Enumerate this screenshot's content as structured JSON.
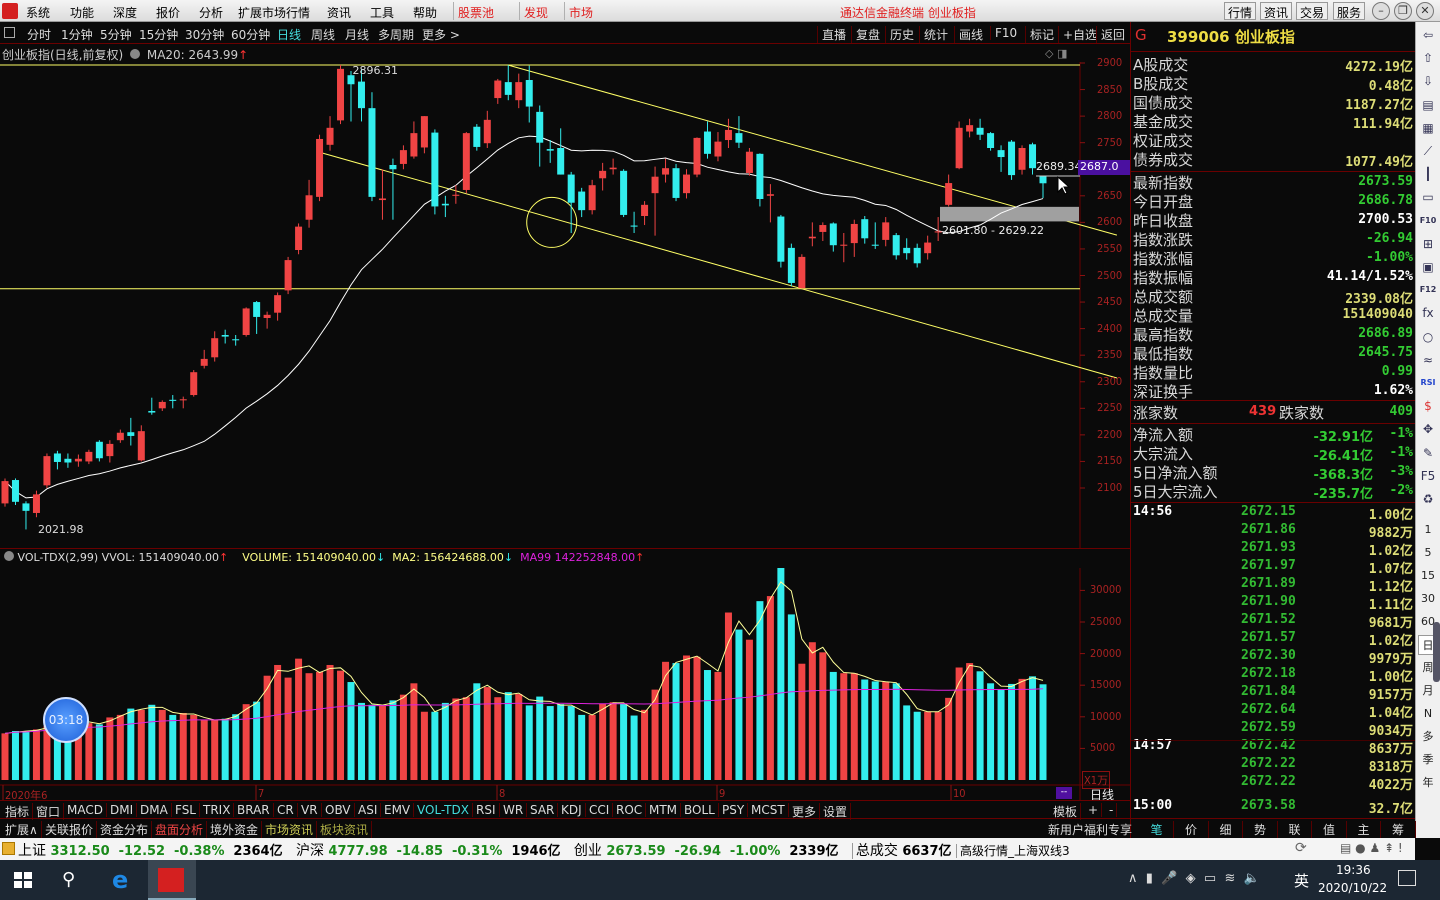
{
  "menubar": {
    "items": [
      "系统",
      "功能",
      "深度",
      "报价",
      "分析",
      "扩展市场行情",
      "资讯",
      "工具",
      "帮助"
    ],
    "special": [
      "股票池",
      "发现",
      "市场"
    ],
    "title": "通达信金融终端 创业板指",
    "right_buttons": [
      "行情",
      "资讯",
      "交易",
      "服务"
    ]
  },
  "toolbar": {
    "periods": [
      "分时",
      "1分钟",
      "5分钟",
      "15分钟",
      "30分钟",
      "60分钟",
      "日线",
      "周线",
      "月线",
      "多周期",
      "更多 >"
    ],
    "active_period": "日线",
    "actions": [
      "直播",
      "复盘",
      "历史",
      "统计",
      "画线",
      "F10",
      "标记",
      "+自选",
      "返回"
    ]
  },
  "chart_info": {
    "name": "创业板指(日线,前复权)",
    "ma20": "MA20: 2643.99"
  },
  "colors": {
    "up": "#f04444",
    "down": "#33eeee",
    "ma20": "#ffffff",
    "vol_ma2": "#ffff99",
    "vol_ma99": "#dd22dd",
    "drawing": "#ffff66",
    "axis": "#a82222"
  },
  "chart_data": [
    {
      "type": "candlestick",
      "title": "创业板指(日线,前复权)",
      "ylim": [
        2100,
        2900
      ],
      "yticks": [
        2900,
        2850,
        2800,
        2750,
        2700,
        2650,
        2600,
        2550,
        2500,
        2450,
        2400,
        2350,
        2300,
        2250,
        2200,
        2150,
        2100
      ],
      "xticks": [
        "2020年6",
        "7",
        "8",
        "9",
        "10"
      ],
      "ohlc": [
        [
          2071,
          2118,
          2065,
          2113
        ],
        [
          2115,
          2118,
          2068,
          2074
        ],
        [
          2071,
          2075,
          2022,
          2057
        ],
        [
          2053,
          2095,
          2045,
          2088
        ],
        [
          2105,
          2165,
          2100,
          2160
        ],
        [
          2165,
          2170,
          2135,
          2149
        ],
        [
          2155,
          2165,
          2138,
          2148
        ],
        [
          2150,
          2163,
          2140,
          2155
        ],
        [
          2150,
          2172,
          2145,
          2168
        ],
        [
          2187,
          2190,
          2150,
          2156
        ],
        [
          2160,
          2190,
          2148,
          2183
        ],
        [
          2190,
          2210,
          2185,
          2204
        ],
        [
          2205,
          2232,
          2180,
          2198
        ],
        [
          2152,
          2218,
          2150,
          2207
        ],
        [
          2245,
          2270,
          2238,
          2242
        ],
        [
          2250,
          2265,
          2245,
          2262
        ],
        [
          2266,
          2275,
          2250,
          2264
        ],
        [
          2265,
          2272,
          2250,
          2267
        ],
        [
          2275,
          2322,
          2272,
          2318
        ],
        [
          2330,
          2360,
          2325,
          2343
        ],
        [
          2346,
          2395,
          2338,
          2382
        ],
        [
          2388,
          2398,
          2372,
          2385
        ],
        [
          2380,
          2388,
          2368,
          2378
        ],
        [
          2388,
          2440,
          2385,
          2438
        ],
        [
          2450,
          2452,
          2390,
          2422
        ],
        [
          2420,
          2432,
          2400,
          2426
        ],
        [
          2430,
          2468,
          2415,
          2463
        ],
        [
          2472,
          2535,
          2465,
          2529
        ],
        [
          2548,
          2598,
          2540,
          2592
        ],
        [
          2605,
          2680,
          2590,
          2651
        ],
        [
          2648,
          2765,
          2640,
          2757
        ],
        [
          2746,
          2800,
          2735,
          2778
        ],
        [
          2792,
          2896.31,
          2785,
          2889
        ],
        [
          2877,
          2885,
          2790,
          2860
        ],
        [
          2865,
          2888,
          2790,
          2815
        ],
        [
          2815,
          2845,
          2640,
          2648
        ],
        [
          2642,
          2700,
          2605,
          2645
        ],
        [
          2708,
          2720,
          2605,
          2700
        ],
        [
          2710,
          2745,
          2700,
          2736
        ],
        [
          2724,
          2790,
          2720,
          2768
        ],
        [
          2741,
          2800,
          2730,
          2800
        ],
        [
          2769,
          2775,
          2615,
          2630
        ],
        [
          2635,
          2650,
          2610,
          2632
        ],
        [
          2650,
          2670,
          2635,
          2652
        ],
        [
          2661,
          2770,
          2655,
          2768
        ],
        [
          2780,
          2785,
          2735,
          2742
        ],
        [
          2749,
          2810,
          2740,
          2793
        ],
        [
          2834,
          2870,
          2823,
          2867
        ],
        [
          2864,
          2896,
          2830,
          2840
        ],
        [
          2830,
          2880,
          2815,
          2864
        ],
        [
          2868,
          2895,
          2788,
          2818
        ],
        [
          2808,
          2820,
          2705,
          2750
        ],
        [
          2738,
          2755,
          2712,
          2735
        ],
        [
          2740,
          2777,
          2690,
          2690
        ],
        [
          2690,
          2695,
          2580,
          2637
        ],
        [
          2658,
          2665,
          2610,
          2623
        ],
        [
          2623,
          2680,
          2615,
          2670
        ],
        [
          2683,
          2712,
          2660,
          2697
        ],
        [
          2700,
          2720,
          2690,
          2703
        ],
        [
          2697,
          2700,
          2610,
          2614
        ],
        [
          2594,
          2620,
          2580,
          2592
        ],
        [
          2612,
          2640,
          2595,
          2633
        ],
        [
          2655,
          2705,
          2575,
          2686
        ],
        [
          2690,
          2720,
          2675,
          2702
        ],
        [
          2702,
          2710,
          2640,
          2646
        ],
        [
          2655,
          2700,
          2645,
          2690
        ],
        [
          2690,
          2760,
          2685,
          2759
        ],
        [
          2771,
          2790,
          2720,
          2729
        ],
        [
          2724,
          2770,
          2715,
          2752
        ],
        [
          2755,
          2795,
          2740,
          2774
        ],
        [
          2768,
          2800,
          2740,
          2750
        ],
        [
          2693,
          2740,
          2688,
          2733
        ],
        [
          2729,
          2730,
          2630,
          2644
        ],
        [
          2650,
          2672,
          2600,
          2653
        ],
        [
          2611,
          2614,
          2515,
          2526
        ],
        [
          2552,
          2560,
          2480,
          2486
        ],
        [
          2476,
          2540,
          2476,
          2535
        ],
        [
          2570,
          2600,
          2555,
          2573
        ],
        [
          2582,
          2600,
          2565,
          2595
        ],
        [
          2598,
          2600,
          2545,
          2557
        ],
        [
          2556,
          2580,
          2525,
          2558
        ],
        [
          2561,
          2605,
          2535,
          2597
        ],
        [
          2606,
          2612,
          2560,
          2570
        ],
        [
          2558,
          2600,
          2550,
          2556
        ],
        [
          2567,
          2610,
          2555,
          2600
        ],
        [
          2576,
          2580,
          2530,
          2538
        ],
        [
          2552,
          2570,
          2530,
          2542
        ],
        [
          2552,
          2560,
          2515,
          2523
        ],
        [
          2542,
          2575,
          2530,
          2562
        ],
        [
          2581,
          2610,
          2565,
          2583
        ],
        [
          2633,
          2690,
          2630,
          2674
        ],
        [
          2702,
          2790,
          2700,
          2778
        ],
        [
          2771,
          2795,
          2760,
          2783
        ],
        [
          2778,
          2795,
          2755,
          2765
        ],
        [
          2768,
          2770,
          2735,
          2740
        ],
        [
          2736,
          2745,
          2695,
          2723
        ],
        [
          2752,
          2755,
          2680,
          2689
        ],
        [
          2699,
          2745,
          2690,
          2740
        ],
        [
          2747,
          2750,
          2690,
          2702
        ],
        [
          2686.78,
          2686.89,
          2645.75,
          2673.59
        ]
      ],
      "ma_period": 20,
      "annotations": {
        "high_label": "2896.31",
        "low_label": "2021.98",
        "range_label": "2601.80 - 2629.22",
        "range": [
          2601.8,
          2629.22
        ],
        "cursor_label": "2689.34",
        "axis_tag": "2687.0",
        "hlines": [
          2896.31,
          2475
        ],
        "channel_upper": {
          "from": [
            48,
            2896
          ],
          "to": [
            103,
            2576
          ]
        },
        "channel_lower": {
          "from": [
            30,
            2732
          ],
          "to": [
            103,
            2307
          ]
        },
        "circle_at": [
          51,
          2600
        ]
      }
    },
    {
      "type": "bar",
      "title": "VOL-TDX(2,99)",
      "unit_label": "X1万",
      "ylim": [
        0,
        34000
      ],
      "yticks": [
        30000,
        25000,
        20000,
        15000,
        10000,
        5000
      ],
      "legend": {
        "vvol": "VOL-TDX(2,99) VVOL: 151409040.00",
        "volume": "VOLUME: 151409040.00",
        "ma2": "MA2: 156424688.00",
        "ma99": "MA99 142252848.00"
      },
      "values": [
        7380,
        7750,
        7700,
        8000,
        8500,
        8500,
        8800,
        9400,
        9000,
        8800,
        9900,
        10300,
        11300,
        11100,
        11900,
        11100,
        10300,
        10600,
        10300,
        9500,
        9500,
        9700,
        10400,
        12000,
        12400,
        16500,
        18200,
        16200,
        19200,
        16900,
        17100,
        18200,
        17300,
        15500,
        12200,
        11900,
        11800,
        12600,
        13500,
        15300,
        10800,
        10800,
        12200,
        12900,
        13100,
        15300,
        14700,
        13100,
        13900,
        13600,
        11800,
        13200,
        11700,
        12000,
        11700,
        10300,
        10300,
        12100,
        12300,
        12100,
        10200,
        11100,
        14300,
        18700,
        18500,
        19700,
        19500,
        17400,
        17100,
        26500,
        23800,
        22200,
        28300,
        29100,
        33600,
        26200,
        18400,
        21800,
        20200,
        17100,
        16900,
        16900,
        15900,
        15600,
        15500,
        15300,
        11800,
        10800,
        10800,
        10800,
        13000,
        17800,
        18500,
        17200,
        15300,
        14400,
        15200,
        16000,
        16400,
        15141
      ]
    }
  ],
  "timer": "03:18",
  "period_label": "日线",
  "right_panel": {
    "header_code": "G",
    "header_title": "399006 创业板指",
    "volumes": [
      {
        "label": "A股成交",
        "value": "4272.19亿"
      },
      {
        "label": "B股成交",
        "value": "0.48亿"
      },
      {
        "label": "国债成交",
        "value": "1187.27亿"
      },
      {
        "label": "基金成交",
        "value": "111.94亿"
      },
      {
        "label": "权证成交",
        "value": ""
      },
      {
        "label": "债券成交",
        "value": "1077.49亿"
      }
    ],
    "stats": [
      {
        "label": "最新指数",
        "value": "2673.59",
        "c": "g"
      },
      {
        "label": "今日开盘",
        "value": "2686.78",
        "c": "g"
      },
      {
        "label": "昨日收盘",
        "value": "2700.53",
        "c": "w"
      },
      {
        "label": "指数涨跌",
        "value": "-26.94",
        "c": "g"
      },
      {
        "label": "指数涨幅",
        "value": "-1.00%",
        "c": "g"
      },
      {
        "label": "指数振幅",
        "value": "41.14/1.52%",
        "c": "w"
      },
      {
        "label": "总成交额",
        "value": "2339.08亿",
        "c": "y"
      },
      {
        "label": "总成交量",
        "value": "151409040",
        "c": "y"
      },
      {
        "label": "最高指数",
        "value": "2686.89",
        "c": "g"
      },
      {
        "label": "最低指数",
        "value": "2645.75",
        "c": "g"
      },
      {
        "label": "指数量比",
        "value": "0.99",
        "c": "g"
      },
      {
        "label": "深证换手",
        "value": "1.62%",
        "c": "w"
      }
    ],
    "breadth": {
      "up_label": "涨家数",
      "up_value": "439",
      "down_label": "跌家数",
      "down_value": "409"
    },
    "flows": [
      {
        "label": "净流入额",
        "value": "-32.91亿",
        "pct": "-1%"
      },
      {
        "label": "大宗流入",
        "value": "-26.41亿",
        "pct": "-1%"
      },
      {
        "label": "5日净流入额",
        "value": "-368.3亿",
        "pct": "-3%"
      },
      {
        "label": "5日大宗流入",
        "value": "-235.7亿",
        "pct": "-2%"
      }
    ],
    "ticks": [
      {
        "time": "14:56",
        "price": "2672.15",
        "vol": "1.00亿"
      },
      {
        "time": "",
        "price": "2671.86",
        "vol": "9882万"
      },
      {
        "time": "",
        "price": "2671.93",
        "vol": "1.02亿"
      },
      {
        "time": "",
        "price": "2671.97",
        "vol": "1.07亿"
      },
      {
        "time": "",
        "price": "2671.89",
        "vol": "1.12亿"
      },
      {
        "time": "",
        "price": "2671.90",
        "vol": "1.11亿"
      },
      {
        "time": "",
        "price": "2671.52",
        "vol": "9681万"
      },
      {
        "time": "",
        "price": "2671.57",
        "vol": "1.02亿"
      },
      {
        "time": "",
        "price": "2672.30",
        "vol": "9979万"
      },
      {
        "time": "",
        "price": "2672.18",
        "vol": "1.00亿"
      },
      {
        "time": "",
        "price": "2671.84",
        "vol": "9157万"
      },
      {
        "time": "",
        "price": "2672.64",
        "vol": "1.04亿"
      },
      {
        "time": "",
        "price": "2672.59",
        "vol": "9034万"
      },
      {
        "time": "14:57",
        "price": "2672.42",
        "vol": "8637万"
      },
      {
        "time": "",
        "price": "2672.22",
        "vol": "8318万"
      },
      {
        "time": "",
        "price": "2672.22",
        "vol": "4022万"
      },
      {
        "time": "15:00",
        "price": "2673.58",
        "vol": "32.7亿"
      }
    ]
  },
  "sidebar": {
    "icons": [
      {
        "name": "back-arrow-icon",
        "g": "⇦"
      },
      {
        "name": "up-arrow-icon",
        "g": "⇧"
      },
      {
        "name": "down-arrow-icon",
        "g": "⇩"
      },
      {
        "name": "report-icon",
        "g": "▤"
      },
      {
        "name": "table-icon",
        "g": "▦"
      },
      {
        "name": "line-chart-icon",
        "g": "⟋"
      },
      {
        "name": "candles-icon",
        "g": "┃"
      },
      {
        "name": "window-icon",
        "g": "▭"
      },
      {
        "name": "f10-icon",
        "g": "F10"
      },
      {
        "name": "tree-icon",
        "g": "⊞"
      },
      {
        "name": "notebook-icon",
        "g": "▣"
      },
      {
        "name": "f12-icon",
        "g": "F12"
      },
      {
        "name": "function-icon",
        "g": "fx"
      },
      {
        "name": "circle-icon",
        "g": "○"
      },
      {
        "name": "wave-icon",
        "g": "≈"
      },
      {
        "name": "rsi-icon",
        "g": "RSI"
      },
      {
        "name": "dollar-icon",
        "g": "$"
      },
      {
        "name": "move-icon",
        "g": "✥"
      },
      {
        "name": "pencil-icon",
        "g": "✎"
      },
      {
        "name": "f5-icon",
        "g": "F5"
      },
      {
        "name": "refresh-icon",
        "g": "♻"
      }
    ],
    "periods": [
      "1",
      "5",
      "15",
      "30",
      "60",
      "日",
      "周",
      "月",
      "N",
      "多",
      "季",
      "年"
    ]
  },
  "indicators": {
    "items": [
      "指标",
      "窗口",
      "MACD",
      "DMI",
      "DMA",
      "FSL",
      "TRIX",
      "BRAR",
      "CR",
      "VR",
      "OBV",
      "ASI",
      "EMV",
      "VOL-TDX",
      "RSI",
      "WR",
      "SAR",
      "KDJ",
      "CCI",
      "ROC",
      "MTM",
      "BOLL",
      "PSY",
      "MCST",
      "更多",
      "设置"
    ],
    "active": "VOL-TDX",
    "right": [
      "模板",
      "+",
      "-"
    ]
  },
  "ext_tabs": {
    "items": [
      "扩展∧",
      "关联报价",
      "资金分布",
      "盘面分析",
      "境外资金",
      "市场资讯",
      "板块资讯"
    ],
    "promo": "新用户福利专享",
    "right": [
      "笔",
      "价",
      "细",
      "势",
      "联",
      "值",
      "主",
      "筹"
    ]
  },
  "status": {
    "sh_label": "上证",
    "sh": "3312.50",
    "sh_chg": "-12.52",
    "sh_pct": "-0.38%",
    "sh_amt": "2364亿",
    "hs_label": "沪深",
    "hs": "4777.98",
    "hs_chg": "-14.85",
    "hs_pct": "-0.31%",
    "hs_amt": "1946亿",
    "cy_label": "创业",
    "cy": "2673.59",
    "cy_chg": "-26.94",
    "cy_pct": "-1.00%",
    "cy_amt": "2339亿",
    "total_label": "总成交",
    "total": "6637亿",
    "feed": "高级行情_上海双线3"
  },
  "taskbar": {
    "ime": "英",
    "time": "19:36",
    "date": "2020/10/22"
  }
}
